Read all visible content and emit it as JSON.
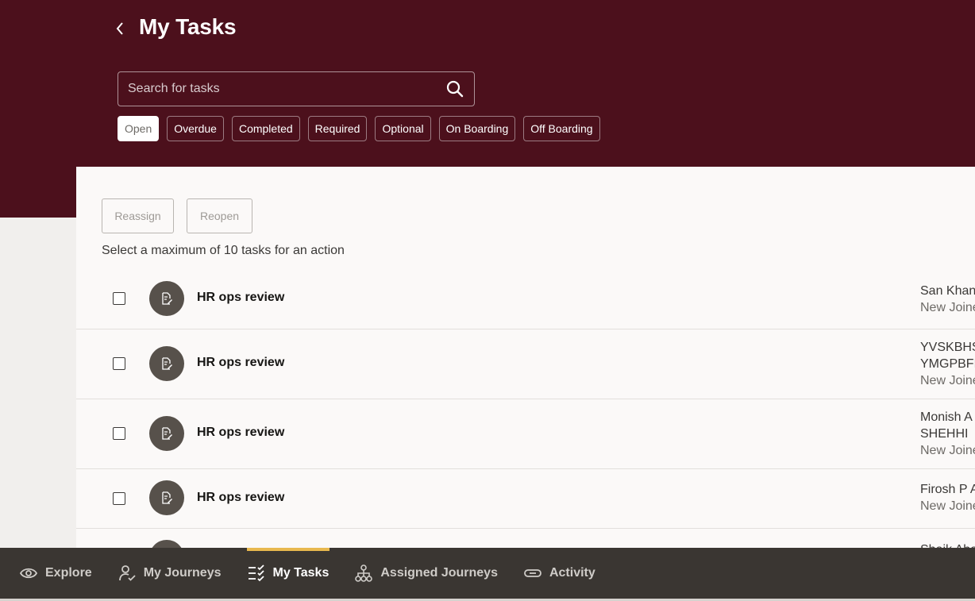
{
  "header": {
    "title": "My Tasks"
  },
  "search": {
    "placeholder": "Search for tasks"
  },
  "filters": [
    "Open",
    "Overdue",
    "Completed",
    "Required",
    "Optional",
    "On Boarding",
    "Off Boarding"
  ],
  "selected_filter": "Open",
  "actions": {
    "reassign_label": "Reassign",
    "reopen_label": "Reopen"
  },
  "hint": "Select a maximum of 10 tasks for an action",
  "tasks": [
    {
      "name": "HR ops review",
      "assignee_lines": [
        "San Khan"
      ],
      "journey": "New Joine"
    },
    {
      "name": "HR ops review",
      "assignee_lines": [
        "YVSKBHS",
        "YMGPBFF"
      ],
      "journey": "New Joine"
    },
    {
      "name": "HR ops review",
      "assignee_lines": [
        "Monish A",
        "SHEHHI"
      ],
      "journey": "New Joine"
    },
    {
      "name": "HR ops review",
      "assignee_lines": [
        "Firosh P A"
      ],
      "journey": "New Joine"
    },
    {
      "name": "",
      "assignee_lines": [
        "Shaik Aba"
      ],
      "journey": ""
    }
  ],
  "nav": {
    "items": [
      {
        "label": "Explore",
        "icon": "eye-icon"
      },
      {
        "label": "My Journeys",
        "icon": "person-check-icon"
      },
      {
        "label": "My Tasks",
        "icon": "checklist-icon"
      },
      {
        "label": "Assigned Journeys",
        "icon": "org-chart-icon"
      },
      {
        "label": "Activity",
        "icon": "link-icon"
      }
    ],
    "active": "My Tasks"
  },
  "colors": {
    "header_bg": "#4c101c",
    "nav_bg": "#3a3632",
    "nav_active_indicator": "#e8b84e",
    "task_avatar_bg": "#57514b"
  }
}
